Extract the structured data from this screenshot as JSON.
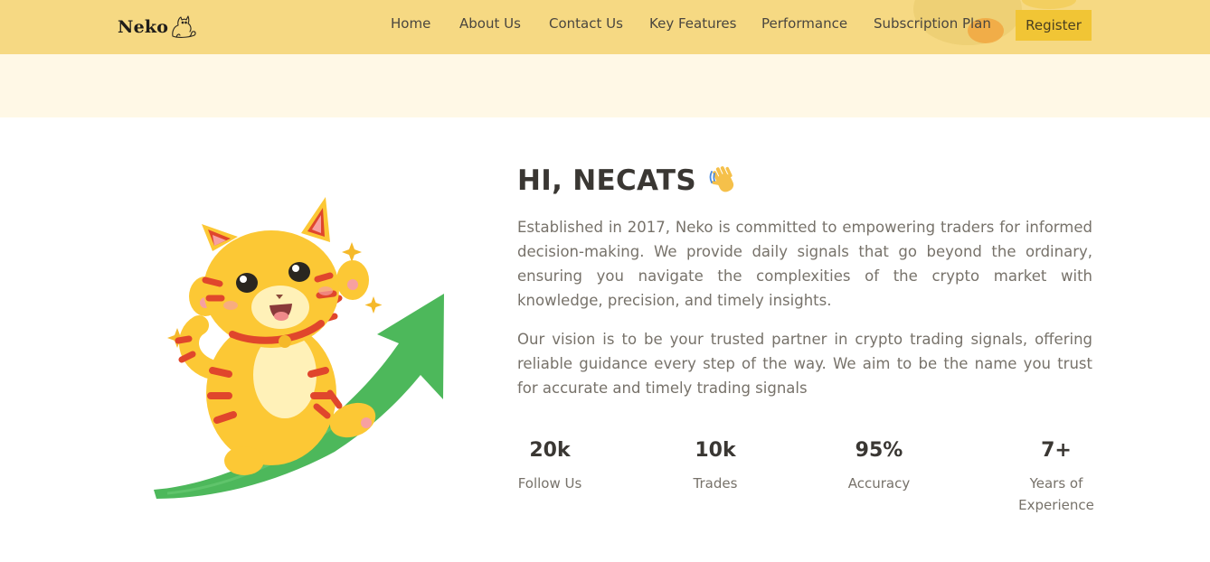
{
  "header": {
    "logo_text": "Neko",
    "nav": [
      {
        "label": "Home"
      },
      {
        "label": "About Us"
      },
      {
        "label": "Contact Us"
      },
      {
        "label": "Key Features"
      },
      {
        "label": "Performance"
      },
      {
        "label": "Subscription Plan"
      }
    ],
    "register_label": "Register"
  },
  "about": {
    "title": "HI, NECATS",
    "paragraph1": "Established in 2017, Neko is committed to empowering traders for informed decision-making. We provide daily signals that go beyond the ordinary, ensuring you navigate the complexities of the crypto market with knowledge, precision, and timely insights.",
    "paragraph2": "Our vision is to be your trusted partner in crypto trading signals, offering reliable guidance every step of the way. We aim to be the name you trust for accurate and timely trading signals",
    "stats": [
      {
        "value": "20k",
        "label": "Follow Us"
      },
      {
        "value": "10k",
        "label": "Trades"
      },
      {
        "value": "95%",
        "label": "Accuracy"
      },
      {
        "value": "7+",
        "label": "Years of Experience"
      }
    ]
  },
  "colors": {
    "header_bg": "#f6d983",
    "register_bg": "#f1c535",
    "band_bg": "#fff8e6",
    "arrow_green": "#4db85b",
    "cat_yellow": "#fcc835",
    "cat_stripe": "#e0462c"
  },
  "icons": {
    "title_icon": "waving-hand-icon",
    "logo_icon": "cat-outline-icon"
  }
}
